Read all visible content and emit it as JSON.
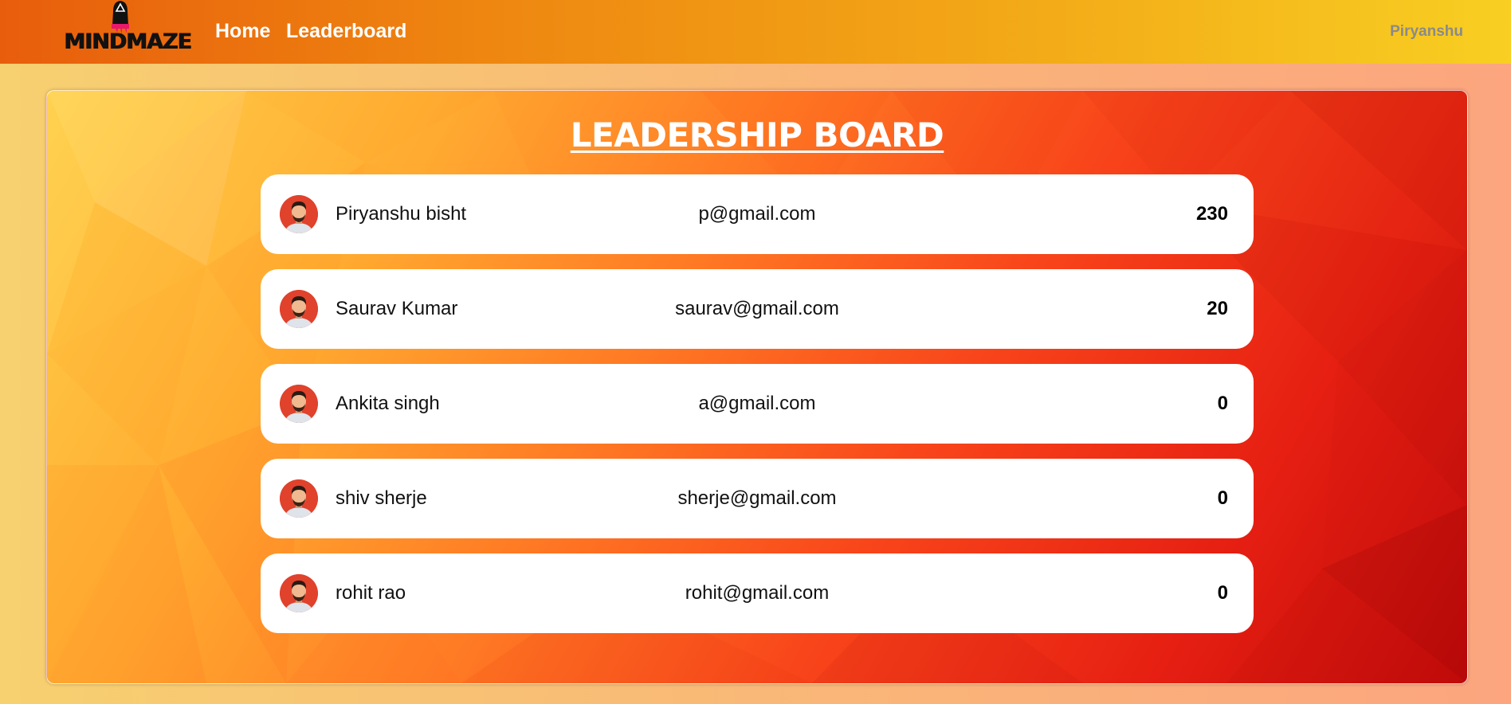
{
  "brand": {
    "logo_text": "MINDMAZE",
    "colors": {
      "nav_start": "#e85d0c",
      "nav_end": "#f8cf22",
      "logo_accent": "#e8186a"
    }
  },
  "nav": {
    "links": [
      {
        "label": "Home"
      },
      {
        "label": "Leaderboard"
      }
    ],
    "user_name": "Piryanshu"
  },
  "board": {
    "title": "LEADERSHIP BOARD",
    "avatar_icon": "user-avatar-icon",
    "rows": [
      {
        "name": "Piryanshu bisht",
        "email": "p@gmail.com",
        "score": "230"
      },
      {
        "name": "Saurav Kumar",
        "email": "saurav@gmail.com",
        "score": "20"
      },
      {
        "name": "Ankita singh",
        "email": "a@gmail.com",
        "score": "0"
      },
      {
        "name": "shiv sherje",
        "email": "sherje@gmail.com",
        "score": "0"
      },
      {
        "name": "rohit rao",
        "email": "rohit@gmail.com",
        "score": "0"
      }
    ]
  }
}
